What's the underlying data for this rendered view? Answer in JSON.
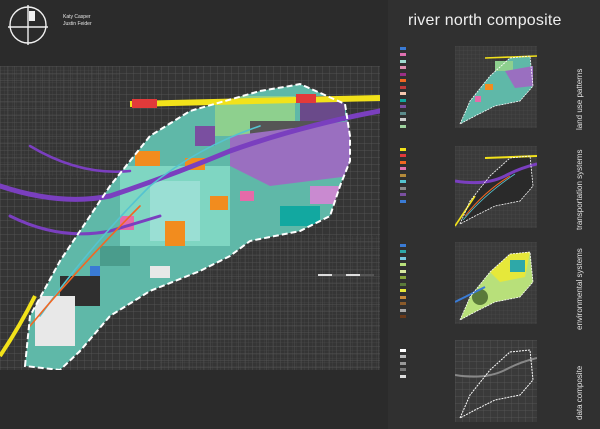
{
  "authors": [
    "Katy Casper",
    "Justin Feider"
  ],
  "title": "river north composite",
  "main_map": {
    "description_paragraphs": [
      "",
      "",
      "",
      "",
      "",
      ""
    ]
  },
  "sections": [
    {
      "label": "land use patterns",
      "legend": [
        {
          "color": "#3a7bd5",
          "text": ""
        },
        {
          "color": "#e070b0",
          "text": ""
        },
        {
          "color": "#a0dcd0",
          "text": ""
        },
        {
          "color": "#e08fb0",
          "text": ""
        },
        {
          "color": "#9a2f86",
          "text": ""
        },
        {
          "color": "#f26722",
          "text": ""
        },
        {
          "color": "#c23a3a",
          "text": ""
        },
        {
          "color": "#f7c7b0",
          "text": ""
        },
        {
          "color": "#12a8a0",
          "text": ""
        },
        {
          "color": "#7a4fa0",
          "text": ""
        },
        {
          "color": "#5a8a8a",
          "text": ""
        },
        {
          "color": "#cfcfcf",
          "text": ""
        },
        {
          "color": "#9fd29f",
          "text": ""
        }
      ]
    },
    {
      "label": "transportation systems",
      "legend": [
        {
          "color": "#f2e21a",
          "text": ""
        },
        {
          "color": "#e23a3a",
          "text": ""
        },
        {
          "color": "#f26722",
          "text": ""
        },
        {
          "color": "#e070b0",
          "text": ""
        },
        {
          "color": "#b48a3a",
          "text": ""
        },
        {
          "color": "#55c4d0",
          "text": ""
        },
        {
          "color": "#8a8a8a",
          "text": ""
        },
        {
          "color": "#7a4fa0",
          "text": ""
        },
        {
          "color": "#3a7bd5",
          "text": ""
        }
      ]
    },
    {
      "label": "environmental systems",
      "legend": [
        {
          "color": "#3a7bd5",
          "text": ""
        },
        {
          "color": "#2ea8a8",
          "text": ""
        },
        {
          "color": "#78c8e0",
          "text": ""
        },
        {
          "color": "#b8e07a",
          "text": ""
        },
        {
          "color": "#d8e8a0",
          "text": ""
        },
        {
          "color": "#8aa83a",
          "text": ""
        },
        {
          "color": "#5a7a3a",
          "text": ""
        },
        {
          "color": "#e6e83a",
          "text": ""
        },
        {
          "color": "#c98a3a",
          "text": ""
        },
        {
          "color": "#8a5a2a",
          "text": ""
        },
        {
          "color": "#a8a8a8",
          "text": ""
        },
        {
          "color": "#6a3a1a",
          "text": ""
        }
      ]
    },
    {
      "label": "data composite",
      "legend": [
        {
          "color": "#ffffff",
          "text": ""
        },
        {
          "color": "#bbbbbb",
          "text": ""
        },
        {
          "color": "#999999",
          "text": ""
        },
        {
          "color": "#777777",
          "text": ""
        },
        {
          "color": "#dddddd",
          "text": ""
        }
      ]
    }
  ],
  "colors": {
    "background": "#2b2b2b",
    "panel": "#303030",
    "street_grid": "#5c5c5c",
    "boundary": "#ffffff",
    "highlight_road": "#f2e21a",
    "rail": "#7a3fbf",
    "land_teal": "#7fd6c2",
    "land_orange": "#f28c1e",
    "land_pink": "#e66aa8",
    "land_green": "#8ed08e"
  }
}
